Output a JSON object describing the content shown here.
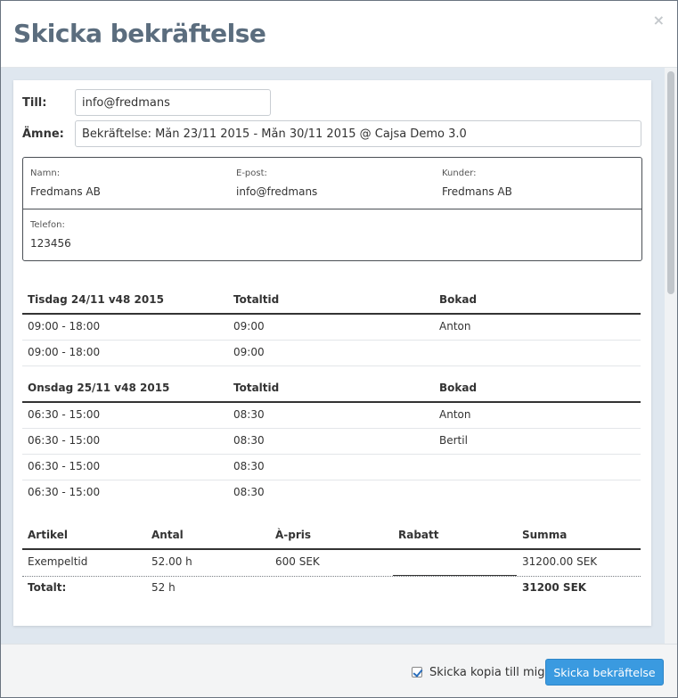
{
  "modal": {
    "title": "Skicka bekräftelse",
    "close_symbol": "×"
  },
  "form": {
    "to_label": "Till:",
    "to_value": "info@fredmans",
    "subject_label": "Ämne:",
    "subject_value": "Bekräftelse: Mån 23/11 2015 - Mån 30/11 2015 @ Cajsa Demo 3.0"
  },
  "info": {
    "name_key": "Namn:",
    "name_val": "Fredmans AB",
    "email_key": "E-post:",
    "email_val": "info@fredmans",
    "customer_key": "Kunder:",
    "customer_val": "Fredmans AB",
    "phone_key": "Telefon:",
    "phone_val": "123456"
  },
  "days": [
    {
      "header": "Tisdag 24/11 v48 2015",
      "col_total": "Totaltid",
      "col_booked": "Bokad",
      "rows": [
        {
          "time": "09:00 - 18:00",
          "total": "09:00",
          "booked": "Anton"
        },
        {
          "time": "09:00 - 18:00",
          "total": "09:00",
          "booked": ""
        }
      ]
    },
    {
      "header": "Onsdag 25/11 v48 2015",
      "col_total": "Totaltid",
      "col_booked": "Bokad",
      "rows": [
        {
          "time": "06:30 - 15:00",
          "total": "08:30",
          "booked": "Anton"
        },
        {
          "time": "06:30 - 15:00",
          "total": "08:30",
          "booked": "Bertil"
        },
        {
          "time": "06:30 - 15:00",
          "total": "08:30",
          "booked": ""
        },
        {
          "time": "06:30 - 15:00",
          "total": "08:30",
          "booked": ""
        }
      ]
    }
  ],
  "articles": {
    "headers": [
      "Artikel",
      "Antal",
      "À-pris",
      "Rabatt",
      "Summa"
    ],
    "rows": [
      [
        "Exempeltid",
        "52.00 h",
        "600 SEK",
        "",
        "31200.00 SEK"
      ]
    ],
    "total": [
      "Totalt:",
      "52 h",
      "",
      "",
      "31200 SEK"
    ]
  },
  "footer": {
    "copy_label": "Skicka kopia till mig",
    "copy_checked": true,
    "send_label": "Skicka bekräftelse"
  },
  "colors": {
    "title": "#5b6d7e",
    "primary_button": "#3a9ae0",
    "body_bg": "#dfe7ef"
  }
}
